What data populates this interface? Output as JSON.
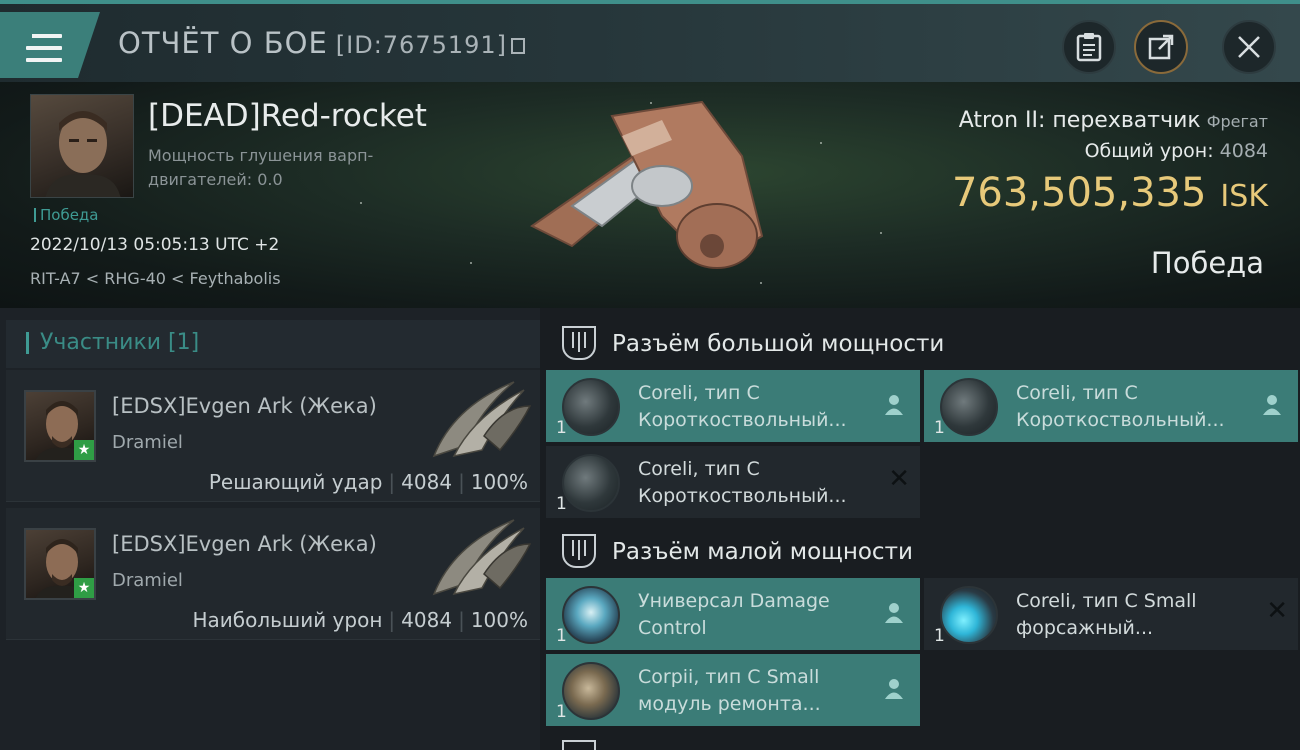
{
  "header": {
    "title": "ОТЧЁТ О БОЕ",
    "report_id": "[ID:7675191]",
    "menu_icon": "menu-icon",
    "buttons": [
      "clipboard-icon",
      "share-icon",
      "close-icon"
    ]
  },
  "victim": {
    "name": "[DEAD]Red-rocket",
    "warp_scramble_label": "Мощность глушения варп-двигателей: 0.0",
    "tag": "Победа",
    "datetime": "2022/10/13 05:05:13 UTC +2",
    "location": "RIT-A7 < RHG-40 < Feythabolis",
    "ship": "Atron II: перехватчик",
    "ship_class": "Фрегат",
    "total_damage_label": "Общий урон:",
    "total_damage": "4084",
    "isk_value": "763,505,335",
    "isk_unit": "ISK",
    "result": "Победа"
  },
  "participants": {
    "header": "Участники [1]",
    "items": [
      {
        "name": "[EDSX]Evgen Ark (Жека)",
        "ship": "Dramiel",
        "role": "Решающий удар",
        "damage": "4084",
        "percent": "100%"
      },
      {
        "name": "[EDSX]Evgen Ark (Жека)",
        "ship": "Dramiel",
        "role": "Наибольший урон",
        "damage": "4084",
        "percent": "100%"
      }
    ]
  },
  "fitting": {
    "high_slot_title": "Разъём большой мощности",
    "low_slot_title": "Разъём малой мощности",
    "high": [
      {
        "qty": "1",
        "line1": "Coreli, тип C",
        "line2": "Короткоствольный...",
        "state": "dropped"
      },
      {
        "qty": "1",
        "line1": "Coreli, тип C",
        "line2": "Короткоствольный...",
        "state": "dropped"
      },
      {
        "qty": "1",
        "line1": "Coreli, тип C",
        "line2": "Короткоствольный...",
        "state": "destroyed"
      }
    ],
    "low": [
      {
        "qty": "1",
        "line1": "Универсал Damage",
        "line2": "Control",
        "state": "dropped"
      },
      {
        "qty": "1",
        "line1": "Coreli, тип C Small",
        "line2": "форсажный...",
        "state": "destroyed"
      },
      {
        "qty": "1",
        "line1": "Corpii, тип C Small",
        "line2": "модуль ремонта...",
        "state": "dropped"
      }
    ],
    "colors": {
      "dropped": "#3b7c77",
      "destroyed": "#22282d"
    }
  },
  "colors": {
    "accent": "#3f9b94",
    "isk": "#e7c97a",
    "background": "#1b1f24"
  }
}
